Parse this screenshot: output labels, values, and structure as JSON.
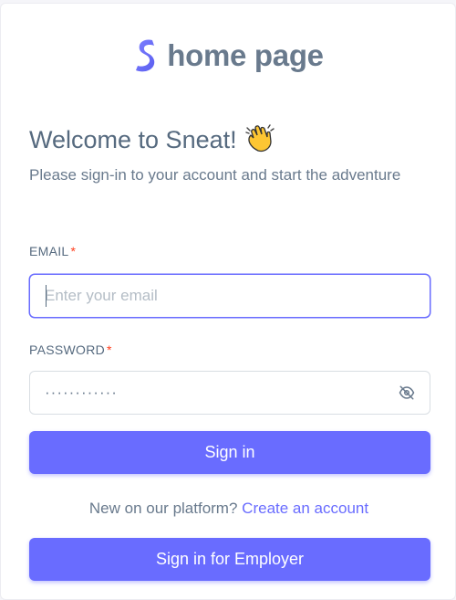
{
  "brand": {
    "name": "home page",
    "color": "#696cff"
  },
  "welcome": {
    "title": "Welcome to Sneat!",
    "subtitle": "Please sign-in to your account and start the adventure"
  },
  "form": {
    "email_label": "EMAIL",
    "email_placeholder": "Enter your email",
    "email_value": "",
    "password_label": "PASSWORD",
    "password_value": "············",
    "required_marker": "*",
    "sign_in_label": "Sign in",
    "employer_label": "Sign in for Employer"
  },
  "register": {
    "prompt": "New on our platform?",
    "link": "Create an account"
  },
  "icons": {
    "logo": "sneat-logo-icon",
    "wave": "waving-hand-icon",
    "eye": "eye-off-icon"
  },
  "colors": {
    "primary": "#696cff",
    "required": "#ff3e1d",
    "text": "#566a7f"
  }
}
